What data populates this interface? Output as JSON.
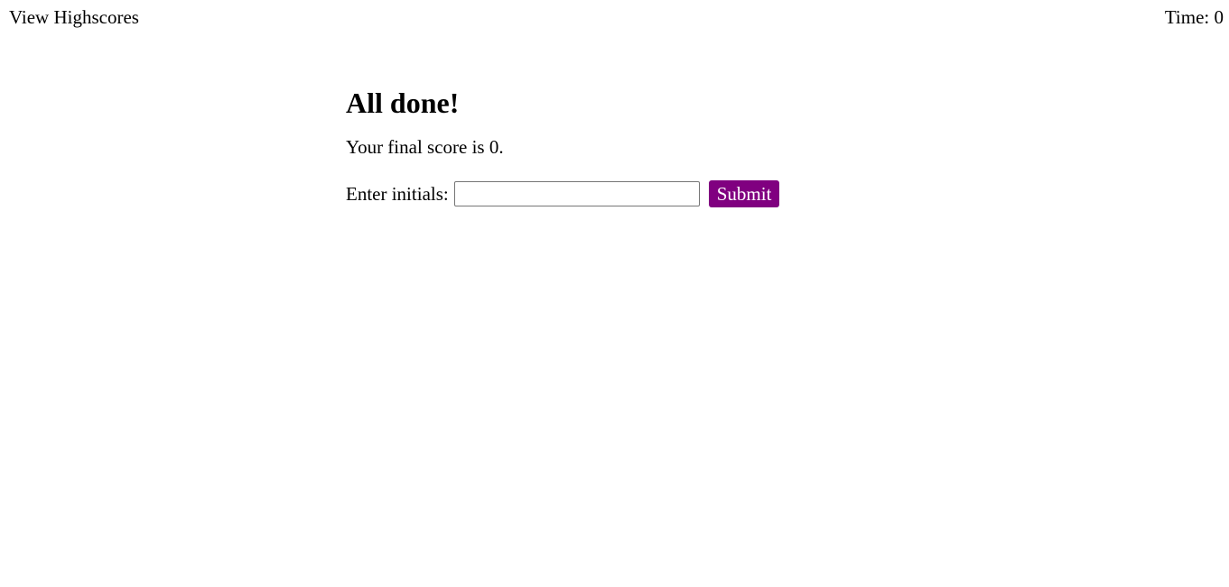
{
  "header": {
    "highscores_link": "View Highscores",
    "timer_label": "Time: ",
    "timer_value": "0"
  },
  "main": {
    "heading": "All done!",
    "score_prefix": "Your final score is ",
    "score_value": "0",
    "score_suffix": ".",
    "initials_label": "Enter initials:",
    "initials_value": "",
    "initials_placeholder": "",
    "submit_label": "Submit"
  },
  "colors": {
    "submit_background": "#800080",
    "submit_text": "#ffffff",
    "text": "#000000",
    "background": "#ffffff"
  }
}
